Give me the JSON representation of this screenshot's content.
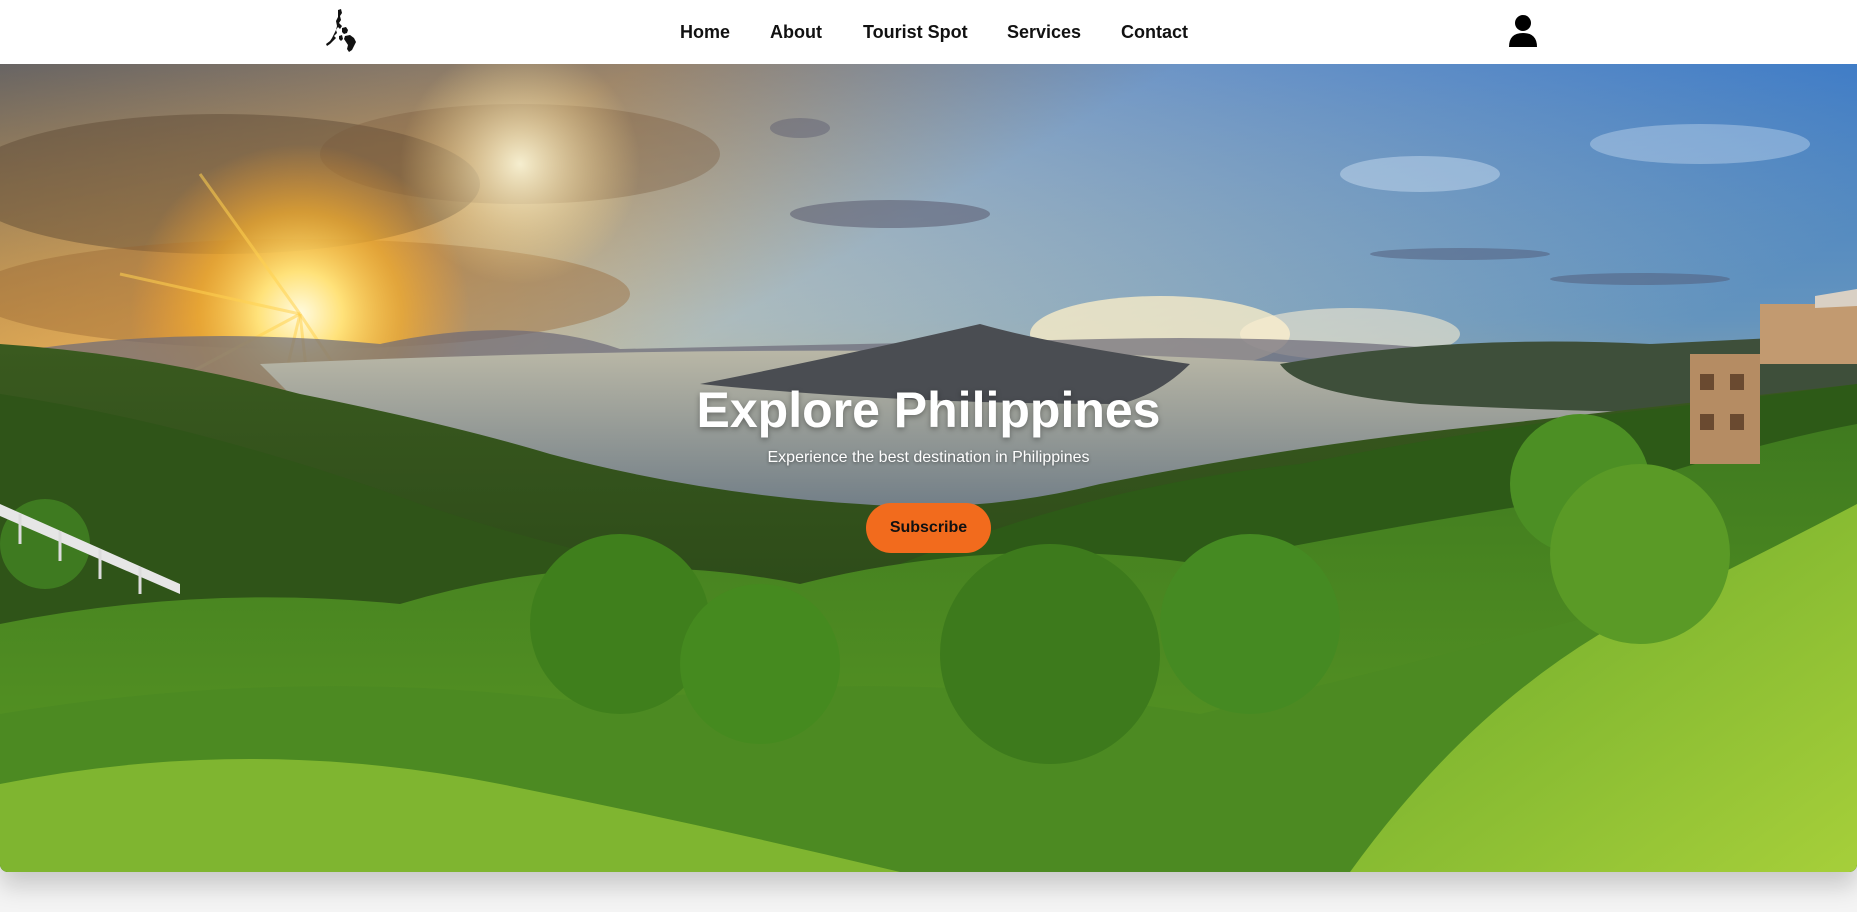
{
  "header": {
    "logo_icon": "philippines-map-icon",
    "nav": [
      {
        "label": "Home"
      },
      {
        "label": "About"
      },
      {
        "label": "Tourist Spot"
      },
      {
        "label": "Services"
      },
      {
        "label": "Contact"
      }
    ],
    "user_icon": "user-icon"
  },
  "hero": {
    "title": "Explore Philippines",
    "subtitle": "Experience the best destination in Philippines",
    "button_label": "Subscribe",
    "background": "taal-lake-sunset-landscape"
  },
  "colors": {
    "accent": "#f26b1d",
    "header_bg": "#ffffff",
    "nav_text": "#111111",
    "hero_text": "#ffffff"
  }
}
